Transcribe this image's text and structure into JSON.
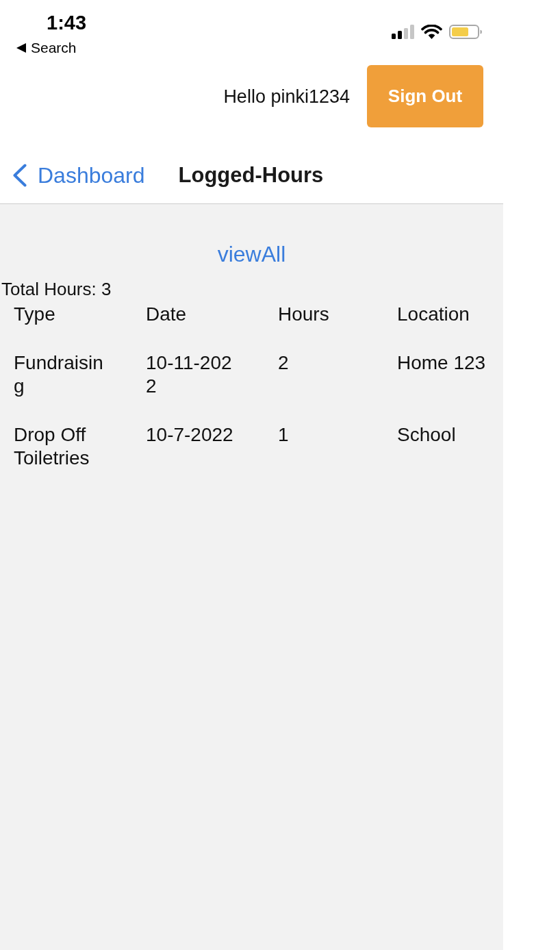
{
  "status_bar": {
    "time": "1:43",
    "back_link": "Search"
  },
  "header": {
    "greeting": "Hello pinki1234",
    "sign_out_button": "Sign Out"
  },
  "nav_bar": {
    "back_button": "Dashboard",
    "title": "Logged-Hours"
  },
  "content": {
    "view_all_link": "viewAll",
    "total_hours": "Total Hours: 3",
    "table": {
      "columns": [
        "Type",
        "Date",
        "Hours",
        "Location"
      ],
      "rows": [
        [
          "Fundraising",
          "10-11-2022",
          "2",
          "Home 123"
        ],
        [
          "Drop Off Toiletries",
          "10-7-2022",
          "1",
          "School"
        ]
      ]
    }
  }
}
